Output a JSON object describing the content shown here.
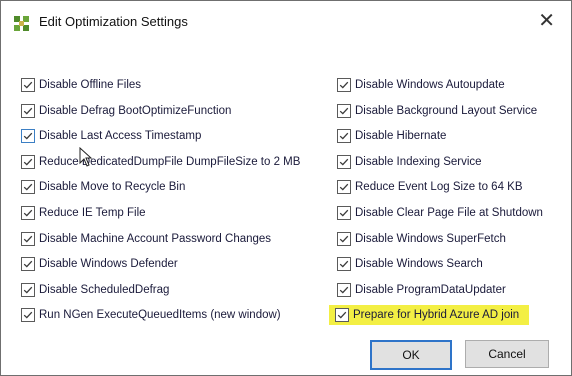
{
  "window": {
    "title": "Edit Optimization Settings",
    "close_glyph": "✕",
    "icon": "app-icon"
  },
  "left_options": [
    "Disable Offline Files",
    "Disable Defrag BootOptimizeFunction",
    "Disable Last Access Timestamp",
    "Reduce DedicatedDumpFile DumpFileSize to 2 MB",
    "Disable Move to Recycle Bin",
    "Reduce IE Temp File",
    "Disable Machine Account Password Changes",
    "Disable Windows Defender",
    "Disable ScheduledDefrag",
    "Run NGen ExecuteQueuedItems (new window)"
  ],
  "right_options": [
    "Disable Windows Autoupdate",
    "Disable Background Layout Service",
    "Disable Hibernate",
    "Disable Indexing Service",
    "Reduce Event Log Size to 64 KB",
    "Disable Clear Page File at Shutdown",
    "Disable Windows SuperFetch",
    "Disable Windows Search",
    "Disable ProgramDataUpdater",
    "Prepare for Hybrid Azure AD join"
  ],
  "buttons": {
    "ok": "OK",
    "cancel": "Cancel"
  },
  "colors": {
    "highlight": "#f3ef44",
    "ok_border": "#2e74c9"
  }
}
